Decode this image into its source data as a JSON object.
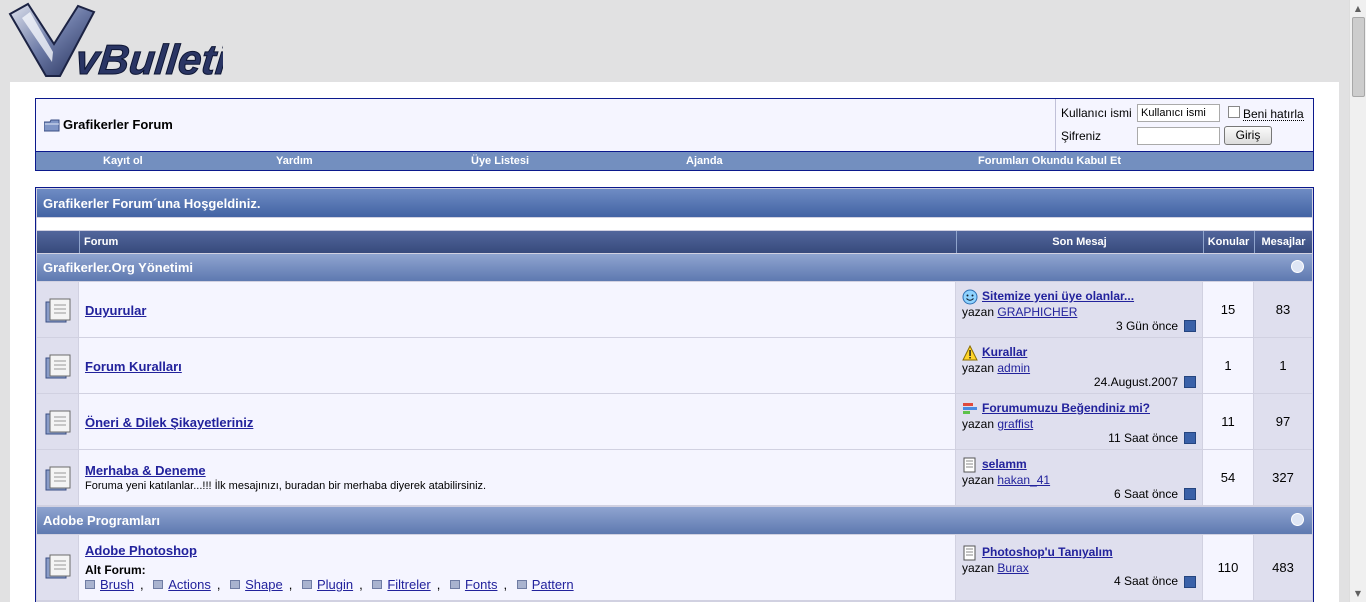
{
  "logo_text": "vBulletin",
  "navbar": {
    "title": "Grafikerler Forum",
    "login": {
      "username_label": "Kullanıcı ismi",
      "username_value": "Kullanıcı ismi",
      "password_label": "Şifreniz",
      "remember_label": "Beni hatırla",
      "login_button": "Giriş"
    },
    "menu": [
      "Kayıt ol",
      "Yardım",
      "Üye Listesi",
      "Ajanda",
      "Forumları Okundu Kabul Et"
    ]
  },
  "welcome": "Grafikerler Forum´una Hoşgeldiniz.",
  "table_headers": {
    "forum": "Forum",
    "last_post": "Son Mesaj",
    "threads": "Konular",
    "posts": "Mesajlar"
  },
  "categories": [
    {
      "name": "Grafikerler.Org Yönetimi",
      "forums": [
        {
          "title": "Duyurular",
          "description": "",
          "last_title": "Sitemize yeni üye olanlar...",
          "last_icon": "smile-icon",
          "last_by_prefix": "yazan",
          "last_user": "GRAPHICHER",
          "last_date": "3 Gün önce",
          "threads": "15",
          "posts": "83"
        },
        {
          "title": "Forum Kuralları",
          "description": "",
          "last_title": "Kurallar",
          "last_icon": "warning-icon",
          "last_by_prefix": "yazan",
          "last_user": "admin",
          "last_date": "24.August.2007",
          "threads": "1",
          "posts": "1"
        },
        {
          "title": "Öneri & Dilek Şikayetleriniz",
          "description": "",
          "last_title": "Forumumuzu Beğendiniz mi?",
          "last_icon": "poll-icon",
          "last_by_prefix": "yazan",
          "last_user": "graffist",
          "last_date": "11 Saat önce",
          "threads": "11",
          "posts": "97"
        },
        {
          "title": "Merhaba & Deneme",
          "description": "Foruma yeni katılanlar...!!! İlk mesajınızı, buradan bir merhaba diyerek atabilirsiniz.",
          "last_title": "selamm",
          "last_icon": "document-icon",
          "last_by_prefix": "yazan",
          "last_user": "hakan_41",
          "last_date": "6 Saat önce",
          "threads": "54",
          "posts": "327"
        }
      ]
    },
    {
      "name": "Adobe Programları",
      "forums": [
        {
          "title": "Adobe Photoshop",
          "subforum_label": "Alt Forum:",
          "subforums": [
            "Brush",
            "Actions",
            "Shape",
            "Plugin",
            "Filtreler",
            "Fonts",
            "Pattern"
          ],
          "last_title": "Photoshop'u Tanıyalım",
          "last_icon": "document-icon",
          "last_by_prefix": "yazan",
          "last_user": "Burax",
          "last_date": "4 Saat önce",
          "threads": "110",
          "posts": "483"
        }
      ]
    }
  ]
}
